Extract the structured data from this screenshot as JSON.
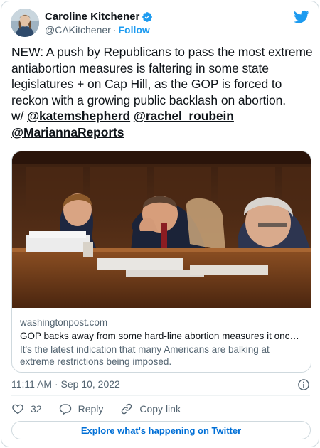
{
  "author": {
    "display_name": "Caroline Kitchener",
    "handle": "@CAKitchener",
    "separator": "·",
    "follow_label": "Follow"
  },
  "tweet": {
    "text": "NEW: A push by Republicans to pass the most extreme antiabortion measures is faltering in some state legislatures + on Cap Hill, as the GOP is forced to reckon with a growing public backlash on abortion.",
    "with_prefix": "w/",
    "mentions": [
      "@katemshepherd",
      "@rachel_roubein",
      "@MariannaReports"
    ]
  },
  "link_card": {
    "domain": "washingtonpost.com",
    "title": "GOP backs away from some hard-line abortion measures it once ch...",
    "description": "It's the latest indication that many Americans are balking at extreme restrictions being imposed."
  },
  "timestamp": "11:11 AM · Sep 10, 2022",
  "actions": {
    "like_count": "32",
    "reply_label": "Reply",
    "copy_link_label": "Copy link"
  },
  "explore_label": "Explore what's happening on Twitter",
  "colors": {
    "accent": "#1d9bf0",
    "link_blue": "#006fd6",
    "muted_text": "#536471",
    "border": "#cfd9de"
  },
  "icons": [
    "verified-badge-icon",
    "twitter-bird-icon",
    "info-icon",
    "heart-icon",
    "reply-bubble-icon",
    "link-icon"
  ]
}
